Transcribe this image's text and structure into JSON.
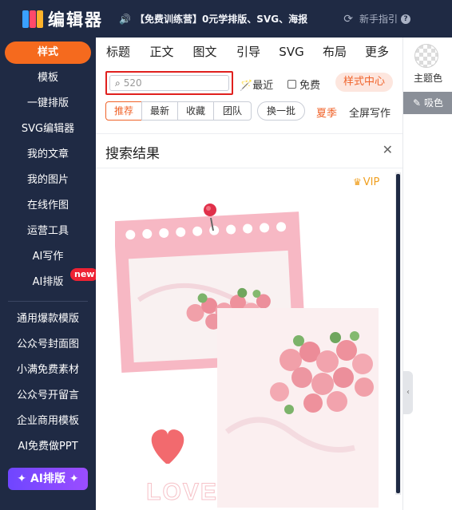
{
  "header": {
    "logo_text": "编辑器",
    "promo_text": "【免费训练营】0元学排版、SVG、海报",
    "guide_text": "新手指引"
  },
  "sidebar": {
    "items": [
      {
        "label": "样式",
        "active": true
      },
      {
        "label": "模板"
      },
      {
        "label": "一键排版"
      },
      {
        "label": "SVG编辑器"
      },
      {
        "label": "我的文章"
      },
      {
        "label": "我的图片"
      },
      {
        "label": "在线作图"
      },
      {
        "label": "运营工具"
      },
      {
        "label": "AI写作"
      },
      {
        "label": "AI排版",
        "badge": "new"
      }
    ],
    "links": [
      {
        "label": "通用爆款模版"
      },
      {
        "label": "公众号封面图"
      },
      {
        "label": "小满免费素材"
      },
      {
        "label": "公众号开留言"
      },
      {
        "label": "企业商用模板"
      },
      {
        "label": "AI免费做PPT"
      }
    ],
    "ai_button_label": "✦ AI排版 ✦"
  },
  "tabs": [
    "标题",
    "正文",
    "图文",
    "引导",
    "SVG",
    "布局",
    "更多"
  ],
  "search": {
    "value": "520",
    "recent_label": "最近",
    "free_label": "免费",
    "style_center_label": "样式中心"
  },
  "filters": {
    "segments": [
      "推荐",
      "最新",
      "收藏",
      "团队"
    ],
    "active_segment": "推荐",
    "batch_label": "换一批",
    "summer_label": "夏季",
    "fullscreen_label": "全屏写作"
  },
  "results": {
    "title": "搜索结果",
    "vip_label": "VIP",
    "card_word": "LOVE"
  },
  "right_panel": {
    "theme_label": "主题色",
    "pick_label": "吸色"
  },
  "colors": {
    "nav_bg": "#1f2a44",
    "accent": "#f56a1e",
    "highlight_border": "#e0201e",
    "ai_gradient_start": "#6f46ff"
  }
}
